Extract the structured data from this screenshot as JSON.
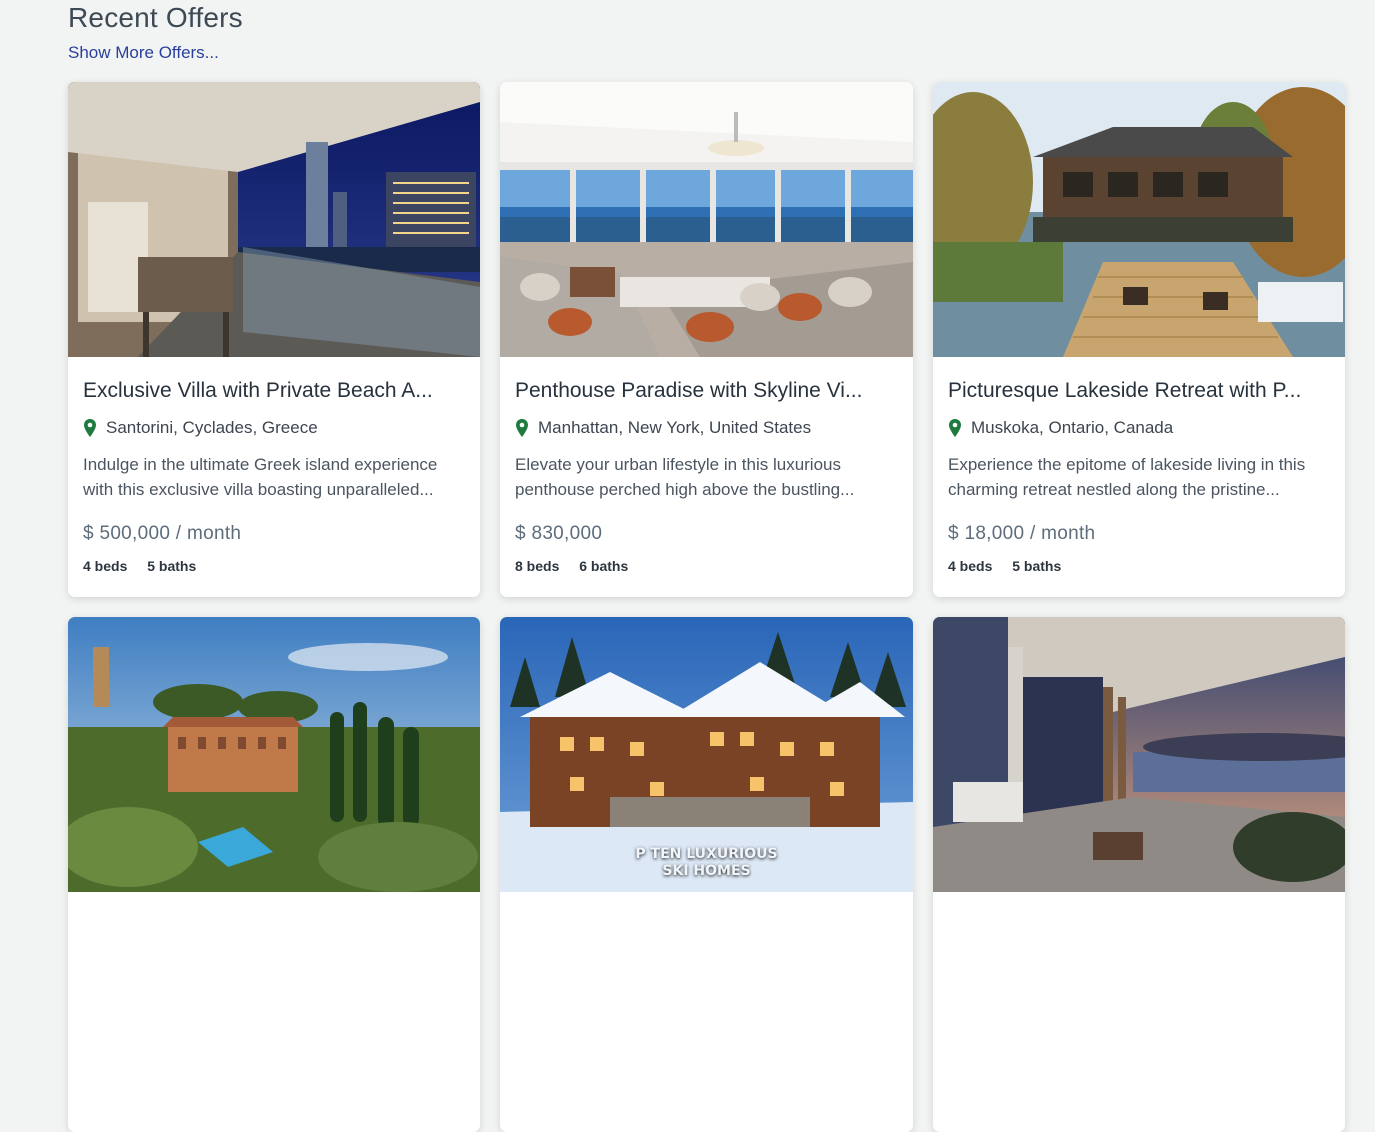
{
  "section": {
    "title": "Recent Offers",
    "show_more": "Show More Offers..."
  },
  "colors": {
    "accent_link": "#2a3f9c",
    "pin": "#1e7a3e",
    "card_bg": "#ffffff",
    "page_bg": "#f1f4f2"
  },
  "offers": [
    {
      "title": "Exclusive Villa with Private Beach A...",
      "location": "Santorini, Cyclades, Greece",
      "description": "Indulge in the ultimate Greek island experience with this exclusive villa boasting unparalleled...",
      "price": "$ 500,000 / month",
      "beds": "4 beds",
      "baths": "5 baths"
    },
    {
      "title": "Penthouse Paradise with Skyline Vi...",
      "location": "Manhattan, New York, United States",
      "description": "Elevate your urban lifestyle in this luxurious penthouse perched high above the bustling...",
      "price": "$ 830,000",
      "beds": "8 beds",
      "baths": "6 baths"
    },
    {
      "title": "Picturesque Lakeside Retreat with P...",
      "location": "Muskoka, Ontario, Canada",
      "description": "Experience the epitome of lakeside living in this charming retreat nestled along the pristine...",
      "price": "$ 18,000 / month",
      "beds": "4 beds",
      "baths": "5 baths"
    },
    {
      "image_overlay_lines": []
    },
    {
      "image_overlay_lines": [
        "P TEN LUXURIOUS",
        "SKI HOMES"
      ]
    },
    {
      "image_overlay_lines": []
    }
  ]
}
